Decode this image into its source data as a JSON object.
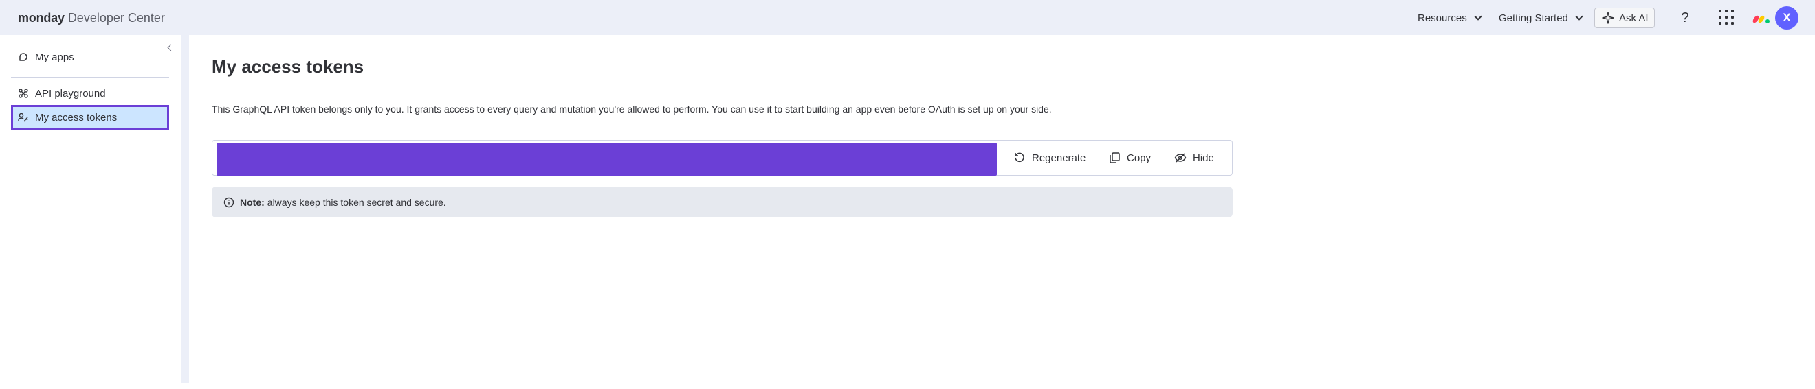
{
  "app": {
    "brand_bold": "monday",
    "brand_rest": "Developer Center"
  },
  "topbar": {
    "resources_label": "Resources",
    "getting_started_label": "Getting Started",
    "ask_ai_label": "Ask AI",
    "help_label": "?",
    "avatar_initial": "X"
  },
  "sidebar": {
    "items": [
      {
        "label": "My apps",
        "icon": "apps-icon"
      },
      {
        "label": "API playground",
        "icon": "playground-icon"
      },
      {
        "label": "My access tokens",
        "icon": "access-token-icon",
        "active": true
      }
    ]
  },
  "main": {
    "title": "My access tokens",
    "description": "This GraphQL API token belongs only to you. It grants access to every query and mutation you're allowed to perform. You can use it to start building an app even before OAuth is set up on your side.",
    "token_actions": {
      "regenerate_label": "Regenerate",
      "copy_label": "Copy",
      "hide_label": "Hide"
    },
    "note": {
      "label": "Note:",
      "text": "always keep this token secret and secure."
    }
  },
  "colors": {
    "accent_purple": "#6b3fd6",
    "topbar_bg": "#eceff8",
    "active_item_bg": "#cce5ff",
    "avatar_bg": "#6161ff"
  }
}
